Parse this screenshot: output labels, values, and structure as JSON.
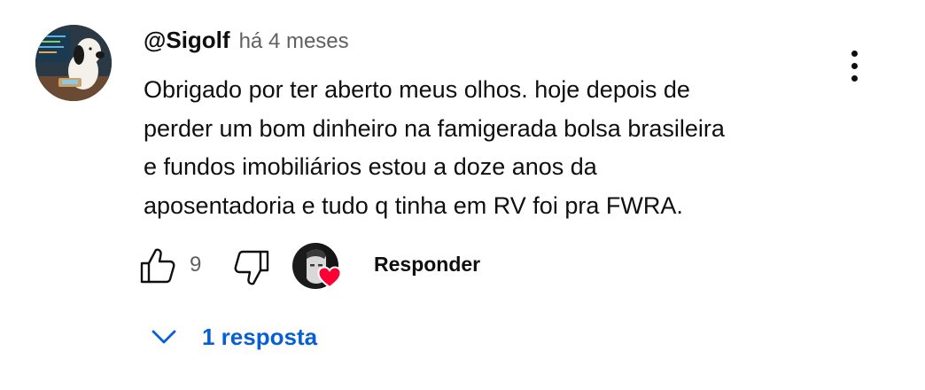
{
  "comment": {
    "author": "@Sigolf",
    "published": "há 4 meses",
    "text_lines": [
      "Obrigado por ter aberto meus olhos. hoje depois de",
      "perder um bom dinheiro na famigerada bolsa brasileira",
      "e fundos imobiliários estou a doze anos da",
      "aposentadoria e tudo q tinha em RV foi pra FWRA."
    ],
    "like_count": "9",
    "reply_label": "Responder",
    "replies_toggle_label": "1 resposta",
    "icons": {
      "avatar": "snoopy-avatar",
      "menu": "more-vertical-icon",
      "like": "thumb-up-icon",
      "dislike": "thumb-down-icon",
      "creator_heart": "heart-icon",
      "replies": "chevron-down-icon"
    },
    "colors": {
      "text": "#0f0f0f",
      "secondary": "#606060",
      "link_blue": "#065fd4",
      "heart_red": "#ff0033"
    }
  }
}
